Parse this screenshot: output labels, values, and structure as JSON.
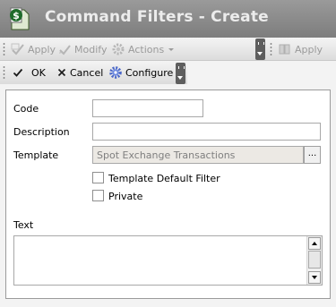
{
  "window": {
    "title": "Command Filters - Create",
    "app_icon": "dollar-document-icon"
  },
  "toolbar_top": {
    "left_items": [
      {
        "label": "Apply",
        "icon": "apply-icon",
        "enabled": false
      },
      {
        "label": "Modify",
        "icon": "modify-icon",
        "enabled": false
      },
      {
        "label": "Actions",
        "icon": "gear-icon",
        "enabled": false
      }
    ],
    "right_items": [
      {
        "label": "Apply",
        "icon": "apply-icon",
        "enabled": false
      }
    ]
  },
  "toolbar_bottom": {
    "items": [
      {
        "label": "OK",
        "icon": "check-icon",
        "enabled": true
      },
      {
        "label": "Cancel",
        "icon": "x-icon",
        "enabled": true
      },
      {
        "label": "Configure",
        "icon": "gear-icon",
        "enabled": true
      }
    ]
  },
  "form": {
    "code_label": "Code",
    "code_value": "",
    "description_label": "Description",
    "description_value": "",
    "template_label": "Template",
    "template_value": "Spot Exchange Transactions",
    "template_browse": "...",
    "template_default_filter_label": "Template Default Filter",
    "template_default_filter_checked": false,
    "private_label": "Private",
    "private_checked": false,
    "text_label": "Text",
    "text_value": ""
  },
  "colors": {
    "titlebar": "#8a8a8a",
    "title_text": "#ececec",
    "readonly_field": "#ece9e4"
  }
}
